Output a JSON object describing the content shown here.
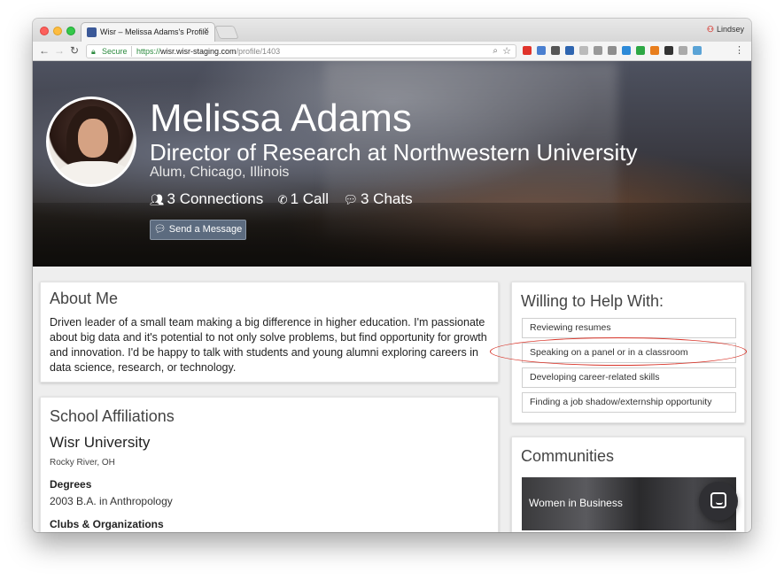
{
  "browser": {
    "tab_title": "Wisr – Melissa Adams's Profile",
    "tab_close": "×",
    "profile_name": "Lindsey",
    "profile_icon": "person-icon",
    "secure_label": "Secure",
    "url_protocol": "https://",
    "url_host": "wisr.wisr-staging.com",
    "url_path": "/profile/1403",
    "nav": {
      "back": "←",
      "forward": "→",
      "reload": "↻"
    },
    "extension_colors": [
      "#e0332b",
      "#4a7fd0",
      "#555555",
      "#2e65b0",
      "#bbbbbb",
      "#999999",
      "#8e8e8e",
      "#2d8ad8",
      "#2ea845",
      "#e87e1d",
      "#333333",
      "#aaaaaa",
      "#5aa3d6"
    ],
    "menu": "⋮"
  },
  "hero": {
    "name": "Melissa Adams",
    "title": "Director of Research at Northwestern University",
    "location": "Alum, Chicago, Illinois",
    "stats": {
      "connections": "3 Connections",
      "calls": "1 Call",
      "chats": "3 Chats"
    },
    "send_message": "Send a Message"
  },
  "about": {
    "heading": "About Me",
    "text": "Driven leader of a small team making a big difference in higher education. I'm passionate about big data and it's potential to not only solve problems, but find opportunity for growth and innovation. I'd be happy to talk with students and young alumni exploring careers in data science, research, or technology."
  },
  "schools": {
    "heading": "School Affiliations",
    "name": "Wisr University",
    "location": "Rocky River, OH",
    "degrees_heading": "Degrees",
    "degree": "2003 B.A. in Anthropology",
    "clubs_heading": "Clubs & Organizations"
  },
  "help": {
    "heading": "Willing to Help With:",
    "items": [
      "Reviewing resumes",
      "Speaking on a panel or in a classroom",
      "Developing career-related skills",
      "Finding a job shadow/externship opportunity"
    ],
    "highlight_color": "#d8352a"
  },
  "communities": {
    "heading": "Communities",
    "items": [
      "Women in Business"
    ]
  }
}
